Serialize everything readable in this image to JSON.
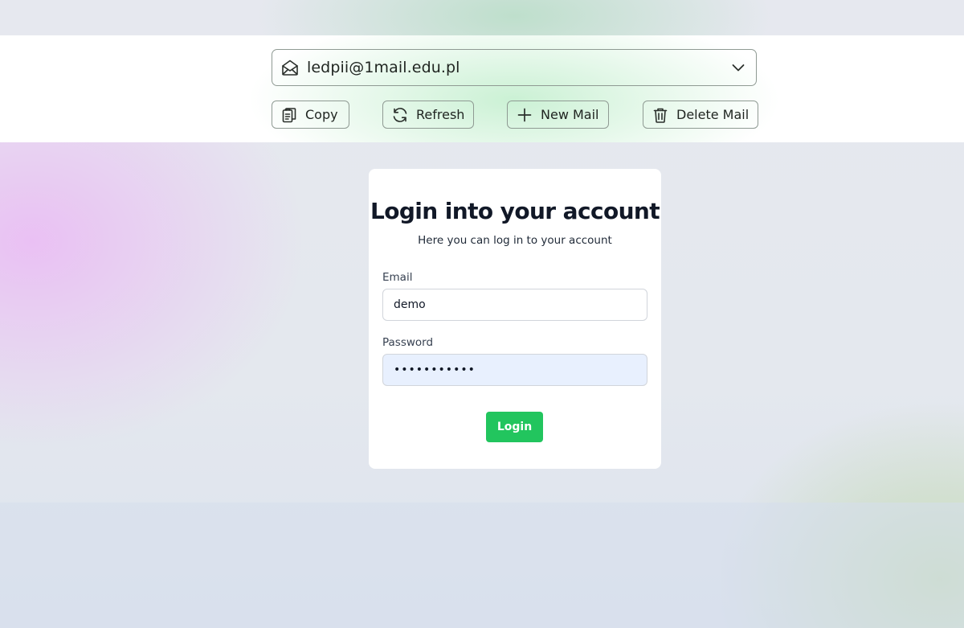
{
  "toolbar": {
    "email_address": "ledpii@1mail.edu.pl",
    "copy_label": "Copy",
    "refresh_label": "Refresh",
    "new_mail_label": "New Mail",
    "delete_mail_label": "Delete Mail"
  },
  "login": {
    "title": "Login into your account",
    "subtitle": "Here you can log in to your account",
    "email_label": "Email",
    "email_value": "demo",
    "password_label": "Password",
    "password_value": "demo1234567",
    "submit_label": "Login"
  },
  "icons": {
    "mailbox": "envelope-open-icon",
    "dropdown": "chevron-down-icon",
    "copy": "clipboard-copy-icon",
    "refresh": "refresh-icon",
    "new_mail": "plus-icon",
    "delete_mail": "trash-icon"
  },
  "colors": {
    "accent": "#22c55e",
    "title_text": "#111827",
    "autofill_bg": "#e8f0fe",
    "border": "#8f9a93"
  }
}
